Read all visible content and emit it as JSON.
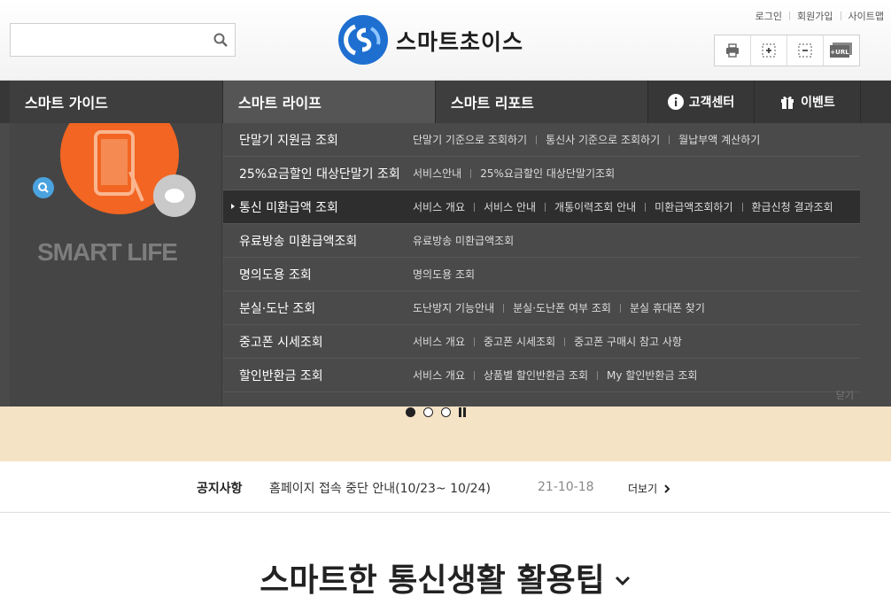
{
  "search": {
    "placeholder": "",
    "value": ""
  },
  "logo": {
    "text": "스마트초이스"
  },
  "top_links": [
    "로그인",
    "회원가입",
    "사이트맵"
  ],
  "tools": [
    {
      "icon": "printer-icon"
    },
    {
      "icon": "zoom-in-icon"
    },
    {
      "icon": "zoom-out-icon"
    },
    {
      "icon": "url-copy-icon",
      "label": "+URL"
    }
  ],
  "nav": {
    "items": [
      "스마트 가이드",
      "스마트 라이프",
      "스마트 리포트"
    ],
    "customer_center": "고객센터",
    "event": "이벤트"
  },
  "left_pane": {
    "caption": "SMART LIFE"
  },
  "menu": [
    {
      "label": "단말기 지원금 조회",
      "subs": [
        "단말기 기준으로 조회하기",
        "통신사 기준으로 조회하기",
        "월납부액 계산하기"
      ]
    },
    {
      "label": "25%요금할인 대상단말기 조회",
      "subs": [
        "서비스안내",
        "25%요금할인 대상단말기조회"
      ]
    },
    {
      "label": "통신 미환급액 조회",
      "active": true,
      "subs": [
        "서비스 개요",
        "서비스 안내",
        "개통이력조회 안내",
        "미환급액조회하기",
        "환급신청 결과조회"
      ]
    },
    {
      "label": "유료방송 미환급액조회",
      "subs": [
        "유료방송 미환급액조회"
      ]
    },
    {
      "label": "명의도용 조회",
      "subs": [
        "명의도용 조회"
      ]
    },
    {
      "label": "분실·도난 조회",
      "subs": [
        "도난방지 기능안내",
        "분실·도난폰 여부 조회",
        "분실 휴대폰 찾기"
      ]
    },
    {
      "label": "중고폰 시세조회",
      "subs": [
        "서비스 개요",
        "중고폰 시세조회",
        "중고폰 구매시 참고 사항"
      ]
    },
    {
      "label": "할인반환금 조회",
      "subs": [
        "서비스 개요",
        "상품별 할인반환금 조회",
        "My 할인반환금 조회"
      ]
    }
  ],
  "close_label": "닫기",
  "slider": {
    "count": 3,
    "active_index": 0
  },
  "notice": {
    "label": "공지사항",
    "title": "홈페이지 접속 중단 안내(10/23~ 10/24)",
    "date": "21-10-18",
    "more": "더보기"
  },
  "section_title": "스마트한 통신생활 활용팁",
  "colors": {
    "nav_bg": "#373737",
    "accent_orange": "#f26522",
    "logo_blue": "#1e6fd0",
    "banner_bg": "#f5e3c6"
  }
}
